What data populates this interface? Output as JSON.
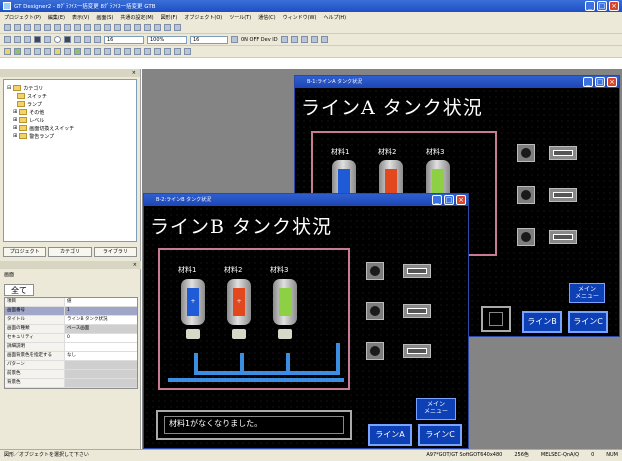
{
  "app": {
    "title": "GT Designer2 - 8ｸﾞﾗﾌｲｽ一括変更 8ｸﾞﾗﾌｲｽ一括変更 GTB",
    "window_buttons": [
      "_",
      "□",
      "×"
    ]
  },
  "menu": [
    "プロジェクト(P)",
    "編集(E)",
    "表示(V)",
    "画面(S)",
    "共通の設定(M)",
    "図形(F)",
    "オブジェクト(O)",
    "ツール(T)",
    "通信(C)",
    "ウィンドウ(W)",
    "ヘルプ(H)"
  ],
  "toolbar": {
    "font_size": "16",
    "zoom": "100%",
    "size2": "16",
    "status_text": "0N OFF  Dev ID"
  },
  "tree": {
    "header": "×",
    "root": "カテゴリ",
    "items": [
      "スイッチ",
      "ランプ",
      "その他",
      "レベル",
      "画面切換えスイッチ",
      "警告ランプ"
    ]
  },
  "left_tabs": [
    "プロジェクト",
    "カテゴリ",
    "ライブラリ"
  ],
  "properties": {
    "header": "×",
    "title": "画面",
    "tab": "全て",
    "rows": [
      {
        "key": "項目",
        "value": "値"
      },
      {
        "key": "画面番号",
        "value": "1"
      },
      {
        "key": "タイトル",
        "value": "ラインB タンク状況"
      },
      {
        "key": "画面の種類",
        "value": "ベース画面"
      },
      {
        "key": "セキュリティ",
        "value": "0"
      },
      {
        "key": "詳細説明",
        "value": ""
      },
      {
        "key": "画面背景色を指定する",
        "value": "なし"
      },
      {
        "key": "パターン",
        "value": ""
      },
      {
        "key": "前景色",
        "value": ""
      },
      {
        "key": "背景色",
        "value": ""
      }
    ]
  },
  "screen_a": {
    "window_title": "B-1:ラインA タンク状況",
    "title": "ラインA タンク状況",
    "materials": [
      "材料1",
      "材料2",
      "材料3"
    ],
    "nav_line_b": "ラインB",
    "nav_line_c": "ラインC",
    "menu_label": "メイン\nメニュー"
  },
  "screen_b": {
    "window_title": "B-2:ラインB タンク状況",
    "title": "ラインB タンク状況",
    "materials": [
      "材料1",
      "材料2",
      "材料3"
    ],
    "alarm": "材料1がなくなりました。",
    "nav_line_a": "ラインA",
    "nav_line_c": "ラインC",
    "menu_label": "メイン\nメニュー"
  },
  "status": {
    "left": "図形／オブジェクトを選択して下さい",
    "device": "A97*GOT/GT SoftGOT640x480",
    "colors": "256色",
    "station": "MELSEC-QnA/Q",
    "coord": "0",
    "size": "NUM"
  },
  "colors": {
    "tank1": "#1f5bd6",
    "tank2": "#e2471d",
    "tank3": "#8ed043",
    "frame": "#c87a96",
    "pipe": "#3b8ee0",
    "nav": "#0d3fb5"
  }
}
